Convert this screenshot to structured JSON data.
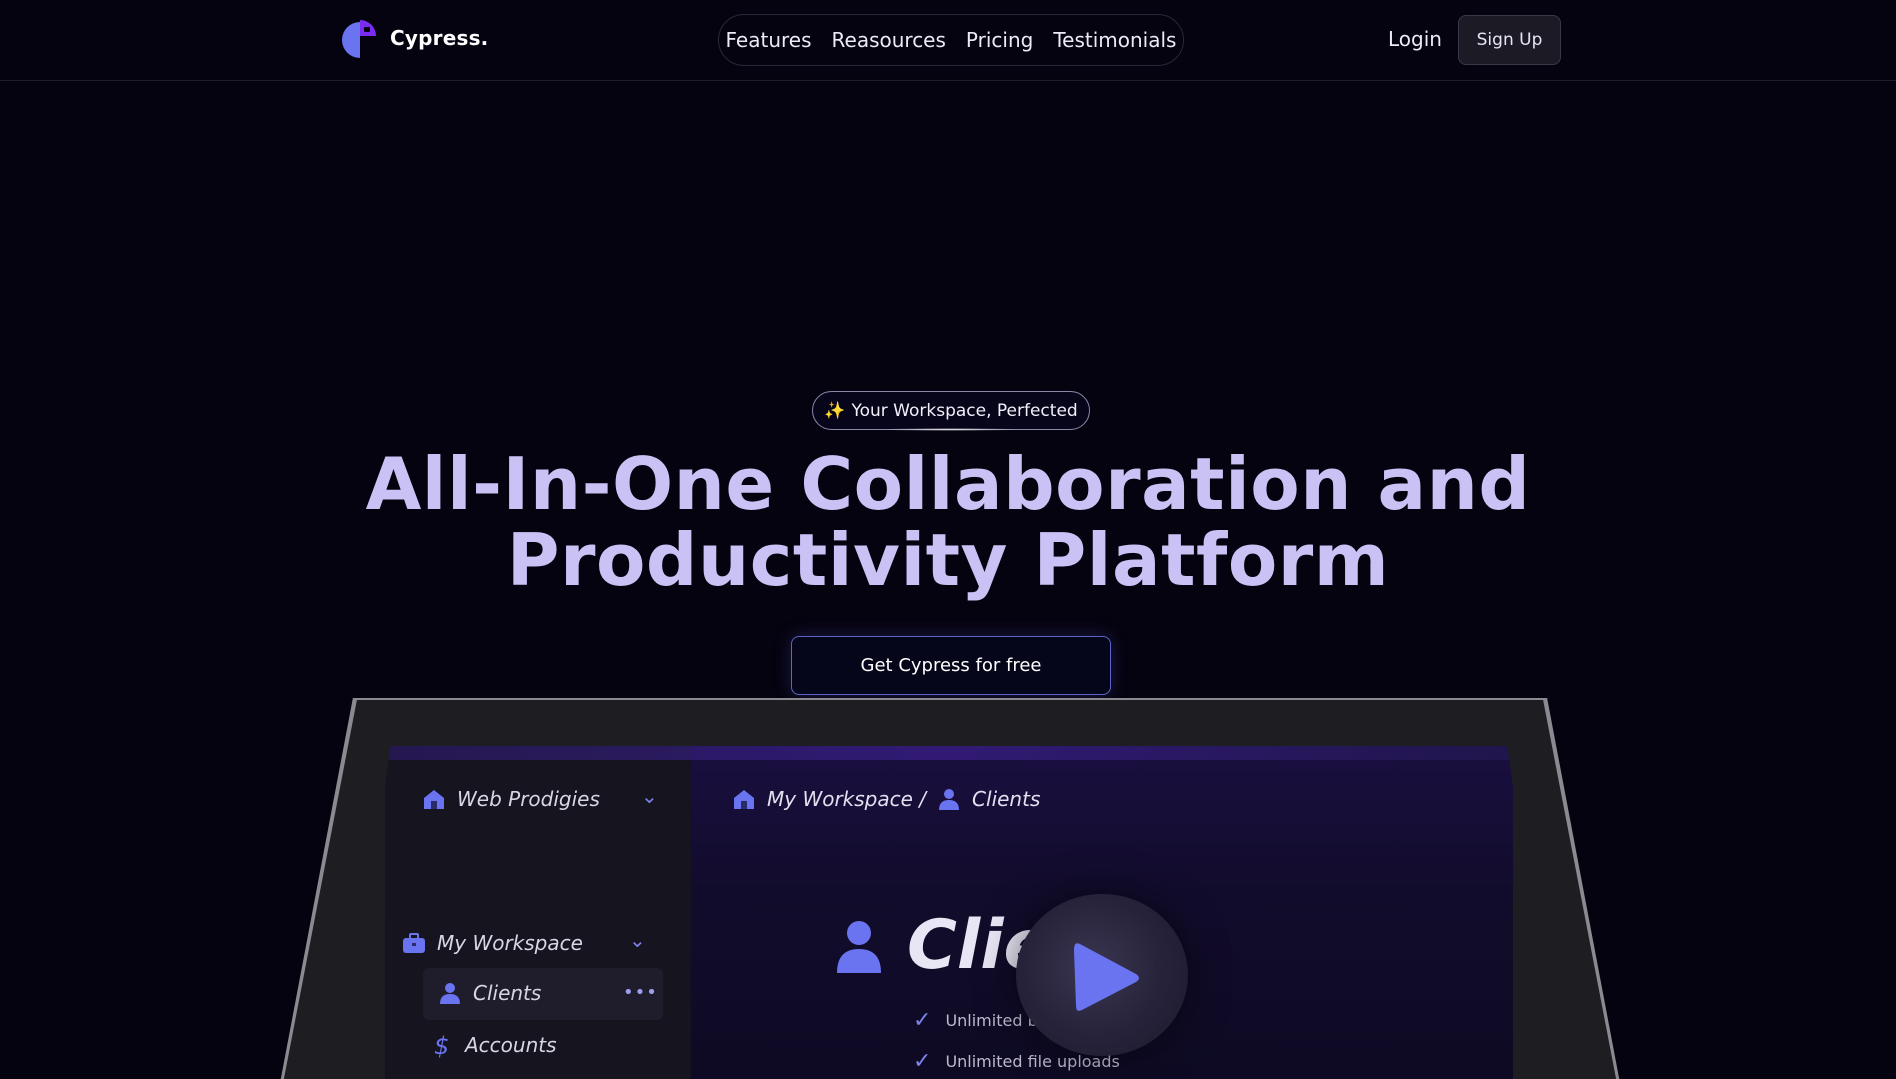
{
  "header": {
    "logo_text": "Cypress.",
    "nav": [
      {
        "label": "Features"
      },
      {
        "label": "Reasources"
      },
      {
        "label": "Pricing"
      },
      {
        "label": "Testimonials"
      }
    ],
    "login_label": "Login",
    "signup_label": "Sign Up"
  },
  "hero": {
    "badge_emoji": "✨",
    "badge_text": "Your Workspace, Perfected",
    "title_line1": "All-In-One Collaboration and",
    "title_line2": "Productivity Platform",
    "cta_label": "Get Cypress for free"
  },
  "app_preview": {
    "workspace_switcher": "Web Prodigies",
    "breadcrumb_root": "My Workspace /",
    "breadcrumb_current": "Clients",
    "section_label": "My Workspace",
    "sidebar_items": [
      {
        "label": "Clients",
        "icon": "user-icon"
      },
      {
        "label": "Accounts",
        "icon": "dollar-icon"
      }
    ],
    "page_heading": "Clie",
    "features": [
      {
        "label": "Unlimited b"
      },
      {
        "label": "Unlimited file uploads"
      }
    ]
  },
  "colors": {
    "background": "#05030f",
    "accent": "#6b74f0",
    "title": "#cac2f5",
    "logo_purple": "#7a2cf0"
  }
}
